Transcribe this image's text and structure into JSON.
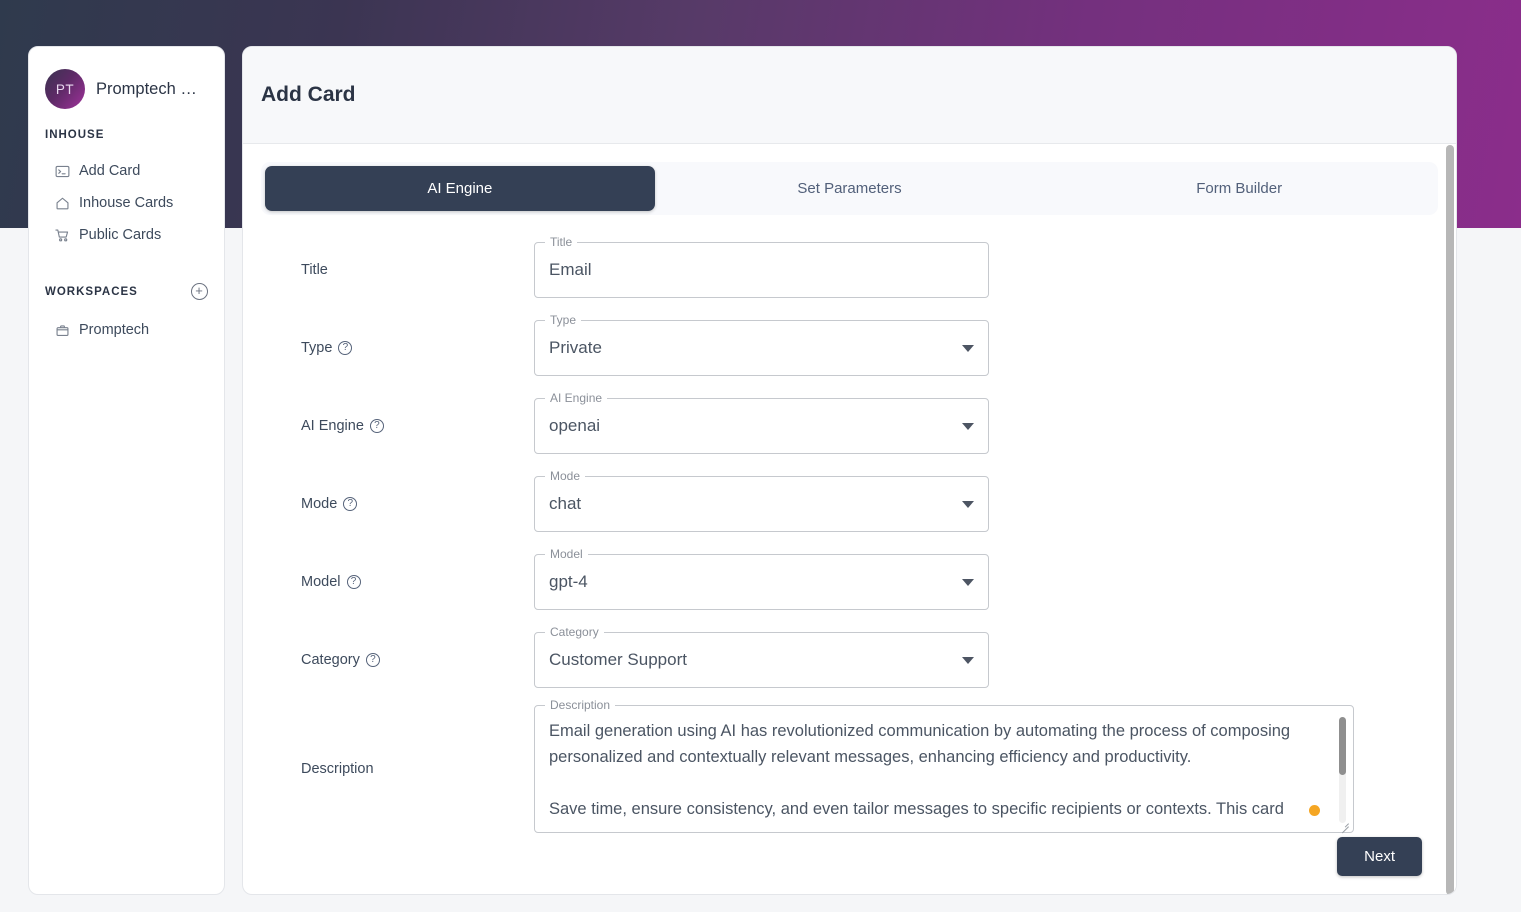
{
  "theme": {
    "gradient_start": "#2f3a4d",
    "gradient_end": "#8b2d8b",
    "accent_dark": "#344055",
    "caret_color": "#f5a623",
    "page_bg": "#f5f6f8"
  },
  "sidebar": {
    "workspace": {
      "initials": "PT",
      "name": "Promptech …"
    },
    "sections": [
      {
        "label": "INHOUSE",
        "items": [
          {
            "label": "Add Card",
            "icon": "terminal-icon"
          },
          {
            "label": "Inhouse Cards",
            "icon": "home-icon"
          },
          {
            "label": "Public Cards",
            "icon": "cart-icon"
          }
        ]
      },
      {
        "label": "WORKSPACES",
        "action_icon": "plus-circle-icon",
        "items": [
          {
            "label": "Promptech",
            "icon": "briefcase-icon"
          }
        ]
      }
    ]
  },
  "main": {
    "header": {
      "title": "Add Card"
    },
    "tabs": [
      {
        "label": "AI Engine",
        "active": true
      },
      {
        "label": "Set Parameters",
        "active": false
      },
      {
        "label": "Form Builder",
        "active": false
      }
    ],
    "form": {
      "rows": [
        {
          "label": "Title",
          "has_help": false,
          "field": {
            "kind": "text",
            "legend": "Title",
            "value": "Email"
          }
        },
        {
          "label": "Type",
          "has_help": true,
          "field": {
            "kind": "select",
            "legend": "Type",
            "value": "Private"
          }
        },
        {
          "label": "AI Engine",
          "has_help": true,
          "field": {
            "kind": "select",
            "legend": "AI Engine",
            "value": "openai"
          }
        },
        {
          "label": "Mode",
          "has_help": true,
          "field": {
            "kind": "select",
            "legend": "Mode",
            "value": "chat"
          }
        },
        {
          "label": "Model",
          "has_help": true,
          "field": {
            "kind": "select",
            "legend": "Model",
            "value": "gpt-4"
          }
        },
        {
          "label": "Category",
          "has_help": true,
          "field": {
            "kind": "select",
            "legend": "Category",
            "value": "Customer Support"
          }
        }
      ],
      "description": {
        "label": "Description",
        "legend": "Description",
        "paragraph_1": "Email generation using AI has revolutionized communication by automating the process of composing personalized and contextually relevant messages, enhancing efficiency and productivity.",
        "paragraph_2": "Save time, ensure consistency, and even tailor messages to specific recipients or contexts. This card"
      }
    },
    "footer": {
      "next_label": "Next"
    }
  },
  "help_glyph": "?"
}
